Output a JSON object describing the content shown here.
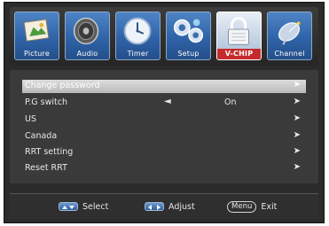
{
  "tabs": [
    {
      "label": "Picture",
      "icon": "picture-icon",
      "active": false
    },
    {
      "label": "Audio",
      "icon": "speaker-icon",
      "active": false
    },
    {
      "label": "Timer",
      "icon": "clock-icon",
      "active": false
    },
    {
      "label": "Setup",
      "icon": "setup-icon",
      "active": false
    },
    {
      "label": "V-CHIP",
      "icon": "lock-icon",
      "active": true
    },
    {
      "label": "Channel",
      "icon": "satellite-dish-icon",
      "active": false
    }
  ],
  "menu": {
    "items": [
      {
        "label": "Change password",
        "value": "",
        "selected": true
      },
      {
        "label": "P.G switch",
        "value": "On",
        "selected": false
      },
      {
        "label": "US",
        "value": "",
        "selected": false
      },
      {
        "label": "Canada",
        "value": "",
        "selected": false
      },
      {
        "label": "RRT setting",
        "value": "",
        "selected": false
      },
      {
        "label": "Reset  RRT",
        "value": "",
        "selected": false
      }
    ],
    "left_arrow": "◄",
    "right_arrow": "➤"
  },
  "footer": {
    "select_label": "Select",
    "adjust_label": "Adjust",
    "menu_key_label": "Menu",
    "exit_label": "Exit"
  },
  "colors": {
    "tab_blue": "#2f63a8",
    "active_tab_label_bg": "#c62b2b",
    "panel_bg": "#3a3a3a",
    "highlight": "#c9c9c9"
  }
}
